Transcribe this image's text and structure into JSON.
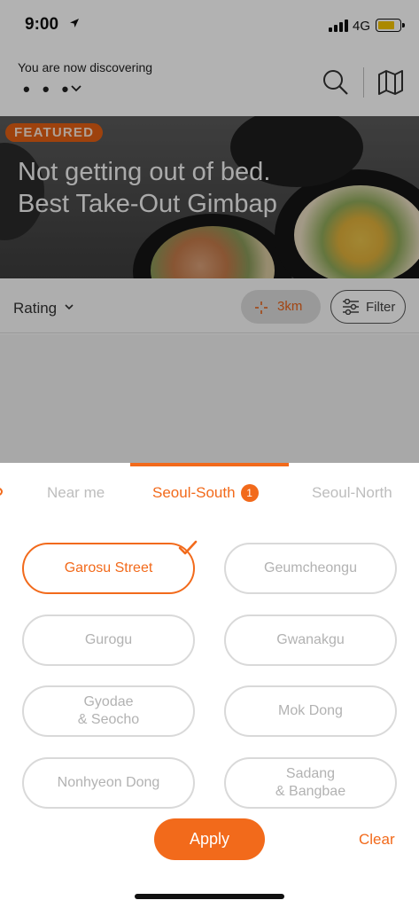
{
  "status_bar": {
    "time": "9:00",
    "network": "4G",
    "battery_color": "#f5c400"
  },
  "header": {
    "discovering_label": "You are now discovering",
    "discovering_value": "• • •",
    "search_icon": "search-icon",
    "map_icon": "map-icon"
  },
  "featured": {
    "badge": "FEATURED",
    "title": "Not getting out of bed.\nBest Take-Out Gimbap"
  },
  "filter_bar": {
    "sort_label": "Rating",
    "distance_label": "3km",
    "filter_label": "Filter"
  },
  "sheet": {
    "tabs": [
      {
        "label": "Near me",
        "active": false
      },
      {
        "label": "Seoul-South",
        "active": true,
        "count": "1"
      },
      {
        "label": "Seoul-North",
        "active": false
      }
    ],
    "areas": [
      {
        "label": "Garosu Street",
        "selected": true
      },
      {
        "label": "Geumcheongu",
        "selected": false
      },
      {
        "label": "Gurogu",
        "selected": false
      },
      {
        "label": "Gwanakgu",
        "selected": false
      },
      {
        "label": "Gyodae\n& Seocho",
        "selected": false
      },
      {
        "label": "Mok Dong",
        "selected": false
      },
      {
        "label": "Nonhyeon Dong",
        "selected": false
      },
      {
        "label": "Sadang\n& Bangbae",
        "selected": false
      }
    ],
    "apply_label": "Apply",
    "clear_label": "Clear"
  },
  "colors": {
    "accent": "#f26a1b",
    "chip_border": "#d9d9d9",
    "chip_text": "#b2b2b2"
  }
}
